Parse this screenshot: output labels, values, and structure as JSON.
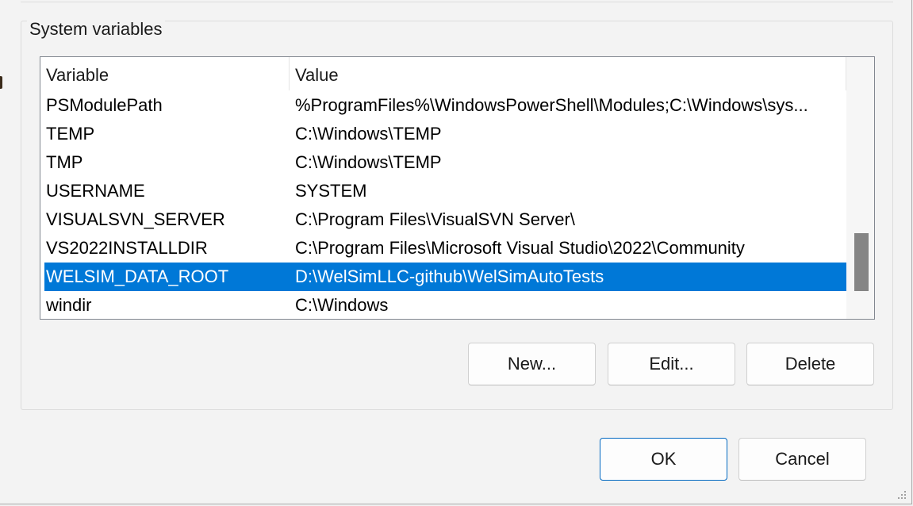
{
  "group": {
    "title": "System variables"
  },
  "list": {
    "columns": {
      "variable": "Variable",
      "value": "Value"
    },
    "rows": [
      {
        "variable": "PSModulePath",
        "value": "%ProgramFiles%\\WindowsPowerShell\\Modules;C:\\Windows\\sys..."
      },
      {
        "variable": "TEMP",
        "value": "C:\\Windows\\TEMP"
      },
      {
        "variable": "TMP",
        "value": "C:\\Windows\\TEMP"
      },
      {
        "variable": "USERNAME",
        "value": "SYSTEM"
      },
      {
        "variable": "VISUALSVN_SERVER",
        "value": "C:\\Program Files\\VisualSVN Server\\"
      },
      {
        "variable": "VS2022INSTALLDIR",
        "value": "C:\\Program Files\\Microsoft Visual Studio\\2022\\Community"
      },
      {
        "variable": "WELSIM_DATA_ROOT",
        "value": "D:\\WelSimLLC-github\\WelSimAutoTests"
      },
      {
        "variable": "windir",
        "value": "C:\\Windows"
      }
    ],
    "selected_index": 6,
    "selection_color": "#0078d7"
  },
  "buttons": {
    "new": "New...",
    "edit": "Edit...",
    "delete": "Delete",
    "ok": "OK",
    "cancel": "Cancel"
  },
  "icons": {
    "resize_grip": "resize-grip-icon"
  }
}
